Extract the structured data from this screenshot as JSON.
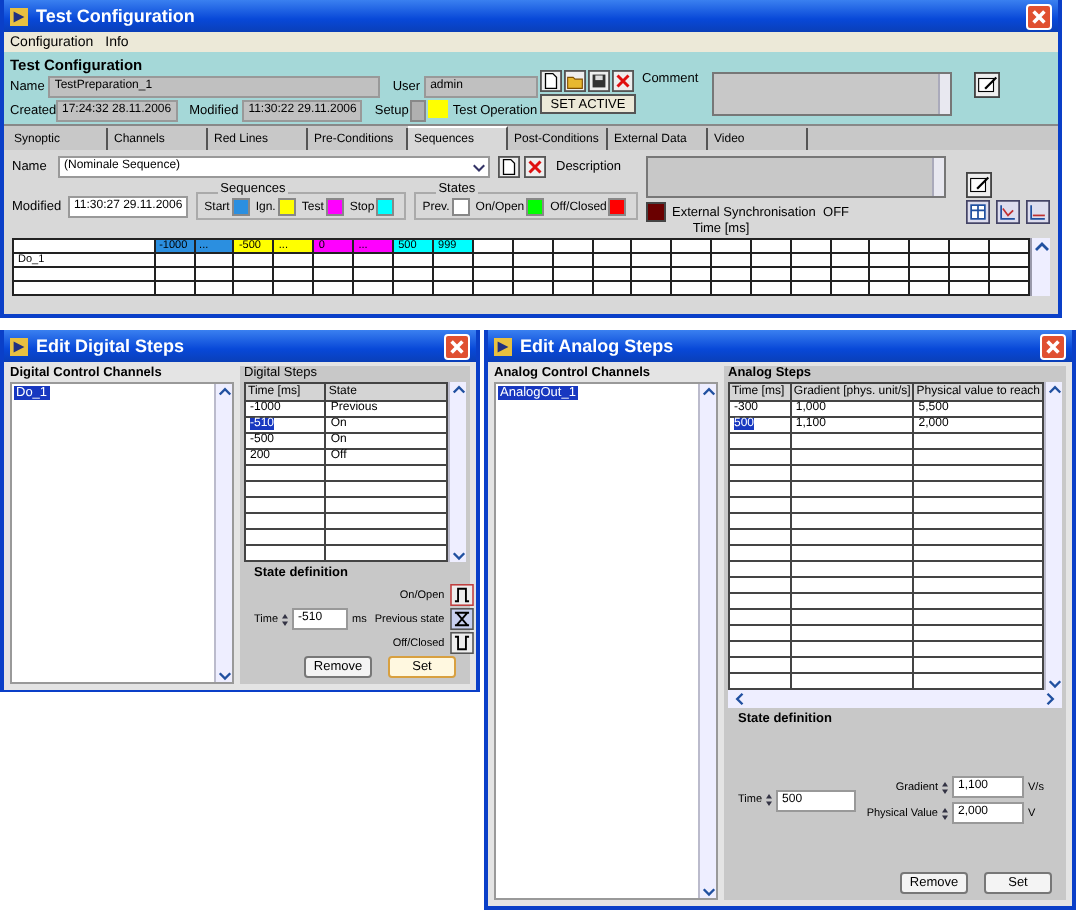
{
  "main_window": {
    "title": "Test Configuration",
    "menu": [
      "Configuration",
      "Info"
    ],
    "header": {
      "heading": "Test Configuration",
      "name_label": "Name",
      "name": "TestPreparation_1",
      "user_label": "User",
      "user": "admin",
      "created_label": "Created",
      "created": "17:24:32 28.11.2006",
      "modified_label": "Modified",
      "modified": "11:30:22 29.11.2006",
      "setup_label": "Setup",
      "test_operation_label": "Test Operation",
      "set_active": "SET ACTIVE",
      "comment_label": "Comment"
    },
    "tabs": [
      {
        "label": "Synoptic",
        "selected": false
      },
      {
        "label": "Channels",
        "selected": false
      },
      {
        "label": "Red Lines",
        "selected": false
      },
      {
        "label": "Pre-Conditions",
        "selected": false
      },
      {
        "label": "Sequences",
        "selected": true
      },
      {
        "label": "Post-Conditions",
        "selected": false
      },
      {
        "label": "External Data",
        "selected": false
      },
      {
        "label": "Video",
        "selected": false
      }
    ],
    "sequence": {
      "name_label": "Name",
      "name": "(Nominale Sequence)",
      "description_label": "Description",
      "modified_label": "Modified",
      "modified": "11:30:27 29.11.2006",
      "sequences_title": "Sequences",
      "sequence_legend": [
        {
          "label": "Start",
          "color": "#2b8fe0"
        },
        {
          "label": "Ign.",
          "color": "#ffff00"
        },
        {
          "label": "Test",
          "color": "#ff00ff"
        },
        {
          "label": "Stop",
          "color": "#00ffff"
        }
      ],
      "states_title": "States",
      "state_legend": [
        {
          "label": "Prev.",
          "color": "#ffffff"
        },
        {
          "label": "On/Open",
          "color": "#00ff00"
        },
        {
          "label": "Off/Closed",
          "color": "#ff0000"
        }
      ],
      "external_sync": {
        "label": "External Synchronisation",
        "value": "OFF",
        "on": false
      },
      "time_label": "Time [ms]",
      "time_cells": [
        {
          "text": "-1000",
          "color": "#2b8fe0"
        },
        {
          "text": "...",
          "color": "#2b8fe0"
        },
        {
          "text": "-500",
          "color": "#ffff00"
        },
        {
          "text": "...",
          "color": "#ffff00"
        },
        {
          "text": "0",
          "color": "#ff00ff"
        },
        {
          "text": "...",
          "color": "#ff00ff"
        },
        {
          "text": "500",
          "color": "#00ffff"
        },
        {
          "text": "999",
          "color": "#00ffff"
        }
      ],
      "channels": [
        "Do_1"
      ]
    }
  },
  "digital_window": {
    "title": "Edit Digital Steps",
    "channels_title": "Digital Control Channels",
    "channels": [
      {
        "name": "Do_1",
        "selected": true
      }
    ],
    "steps_title": "Digital Steps",
    "columns": [
      "Time [ms]",
      "State"
    ],
    "rows": [
      {
        "time": "-1000",
        "state": "Previous",
        "selected": false
      },
      {
        "time": "-510",
        "state": "On",
        "selected": true
      },
      {
        "time": "-500",
        "state": "On",
        "selected": false
      },
      {
        "time": "200",
        "state": "Off",
        "selected": false
      }
    ],
    "state_definition": {
      "title": "State definition",
      "time_label": "Time",
      "time": "-510",
      "unit": "ms",
      "states": [
        {
          "label": "On/Open",
          "kind": "on"
        },
        {
          "label": "Previous state",
          "kind": "previous"
        },
        {
          "label": "Off/Closed",
          "kind": "off"
        }
      ]
    },
    "buttons": [
      "Remove",
      "Set"
    ]
  },
  "analog_window": {
    "title": "Edit Analog Steps",
    "channels_title": "Analog Control Channels",
    "channels": [
      {
        "name": "AnalogOut_1",
        "selected": true
      }
    ],
    "steps_title": "Analog Steps",
    "columns": [
      "Time [ms]",
      "Gradient [phys. unit/s]",
      "Physical value to reach"
    ],
    "rows": [
      {
        "time": "-300",
        "gradient": "1,000",
        "value": "5,500",
        "selected": false
      },
      {
        "time": "500",
        "gradient": "1,100",
        "value": "2,000",
        "selected": true
      }
    ],
    "state_definition": {
      "title": "State definition",
      "time_label": "Time",
      "time": "500",
      "gradient_label": "Gradient",
      "gradient": "1,100",
      "gradient_unit": "V/s",
      "physical_label": "Physical Value",
      "physical": "2,000",
      "physical_unit": "V"
    },
    "buttons": [
      "Remove",
      "Set"
    ]
  }
}
